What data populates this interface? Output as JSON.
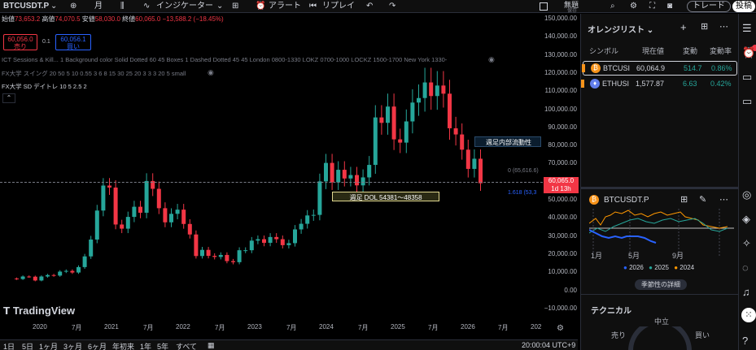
{
  "topbar": {
    "symbol": "BTCUSDT.P",
    "interval": "月",
    "indicators": "インジケーター",
    "alert": "アラート",
    "replay": "リプレイ",
    "unnamed": "無題",
    "saved": "保存",
    "trade": "トレード",
    "post": "投稿"
  },
  "legend": {
    "open_l": "始値",
    "open": "73,653.2",
    "high_l": "高値",
    "high": "74,070.5",
    "low_l": "安値",
    "low": "58,030.0",
    "close_l": "終値",
    "close": "60,065.0",
    "change": "−13,588.2 (−18.45%)",
    "sell_price": "60,056.0",
    "sell": "売り",
    "spread": "0.1",
    "buy_price": "60,056.1",
    "buy": "買い",
    "ind1": "ICT Sessions & Kill... 1 Background color Solid Dotted 60 45 Boxes 1 Dashed Dotted 45 45 London 0800-1330 LOKZ 0700-1000 LOCKZ 1500-1700 New York 1330-",
    "ind2": "FX大学 スイング 20 50 5 10 0.55 3 6 8 15 30 25 20 3 3 3 20 5 small",
    "ind3": "FX大学 SD デイトレ 10 5 2.5 2"
  },
  "annotations": {
    "weekly_liq": "週足内部流動性",
    "weekly_dol": "週足 DOL 54381〜48358",
    "fib1": "0 (65,616.6)",
    "fib2": "1.618 (53,3",
    "price_tag": "60,065.0",
    "countdown": "1d 13h"
  },
  "yaxis": [
    "150,000.00",
    "140,000.00",
    "130,000.00",
    "120,000.00",
    "110,000.00",
    "100,000.00",
    "90,000.00",
    "80,000.00",
    "70,000.00",
    "60,000.00",
    "50,000.00",
    "40,000.00",
    "30,000.00",
    "20,000.00",
    "10,000.00",
    "0.00",
    "−10,000.00"
  ],
  "xaxis": [
    "2020",
    "7月",
    "2021",
    "7月",
    "2022",
    "7月",
    "2023",
    "7月",
    "2024",
    "7月",
    "2025",
    "7月",
    "2026",
    "7月",
    "202"
  ],
  "bottombar": {
    "r1": "1日",
    "r2": "5日",
    "r3": "1ヶ月",
    "r4": "3ヶ月",
    "r5": "6ヶ月",
    "r6": "年初来",
    "r7": "1年",
    "r8": "5年",
    "r9": "すべて",
    "time": "20:00:04 UTC+9"
  },
  "brand": "TradingView",
  "watchlist": {
    "title": "オレンジリスト",
    "cols": [
      "シンボル",
      "現在値",
      "変動",
      "変動率"
    ],
    "rows": [
      {
        "sym": "BTCUSI",
        "price": "60,064.9",
        "chg": "514.7",
        "pct": "0.86%",
        "color": "#f7931a"
      },
      {
        "sym": "ETHUSI",
        "price": "1,577.87",
        "chg": "6.63",
        "pct": "0.42%",
        "color": "#627eea"
      }
    ]
  },
  "seasonal": {
    "symbol": "BTCUSDT.P",
    "months": [
      "1月",
      "5月",
      "9月"
    ],
    "legend": [
      "2026",
      "2025",
      "2024"
    ],
    "legend_colors": [
      "#2962ff",
      "#26a69a",
      "#ff9800"
    ],
    "details": "季節性の詳細"
  },
  "technical": {
    "title": "テクニカル",
    "neutral": "中立",
    "sell": "売り",
    "buy": "買い"
  },
  "chart_data": {
    "type": "candlestick",
    "ylim": [
      -10000,
      150000
    ]
  }
}
